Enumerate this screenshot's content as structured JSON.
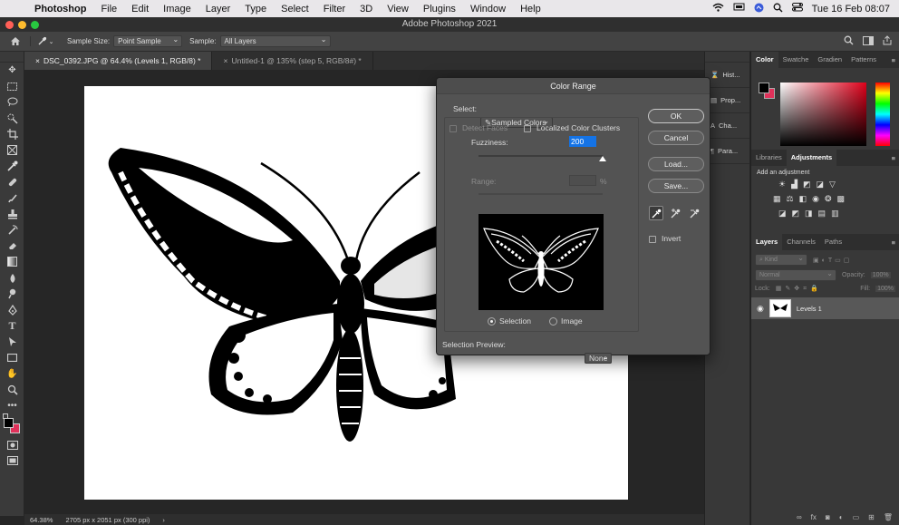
{
  "menubar": {
    "app": "Photoshop",
    "items": [
      "File",
      "Edit",
      "Image",
      "Layer",
      "Type",
      "Select",
      "Filter",
      "3D",
      "View",
      "Plugins",
      "Window",
      "Help"
    ],
    "clock": "Tue 16 Feb  08:07"
  },
  "window": {
    "title": "Adobe Photoshop 2021"
  },
  "options": {
    "sample_size_label": "Sample Size:",
    "sample_size_value": "Point Sample",
    "sample_label": "Sample:",
    "sample_value": "All Layers"
  },
  "tabs": [
    {
      "label": "DSC_0392.JPG @ 64.4% (Levels 1, RGB/8) *"
    },
    {
      "label": "Untitled-1 @ 135% (step 5, RGB/8#) *"
    }
  ],
  "status": {
    "zoom": "64.38%",
    "info": "2705 px x 2051 px (300 ppi)"
  },
  "dock": {
    "items": [
      "Hist...",
      "Prop...",
      "Cha...",
      "Para..."
    ]
  },
  "panels": {
    "color_tabs": [
      "Color",
      "Swatche",
      "Gradien",
      "Patterns"
    ],
    "adj_tabs": [
      "Libraries",
      "Adjustments"
    ],
    "adj_hint": "Add an adjustment",
    "layer_tabs": [
      "Layers",
      "Channels",
      "Paths"
    ],
    "kind": "Kind",
    "blend": "Normal",
    "opacity_label": "Opacity:",
    "opacity_value": "100%",
    "lock_label": "Lock:",
    "fill_label": "Fill:",
    "fill_value": "100%",
    "layer_name": "Levels 1"
  },
  "dialog": {
    "title": "Color Range",
    "select_label": "Select:",
    "select_value": "Sampled Colors",
    "detect_faces": "Detect Faces",
    "localized": "Localized Color Clusters",
    "fuzziness_label": "Fuzziness:",
    "fuzziness_value": "200",
    "fuzziness": 200,
    "range_label": "Range:",
    "range_unit": "%",
    "ok": "OK",
    "cancel": "Cancel",
    "load": "Load...",
    "save": "Save...",
    "invert": "Invert",
    "radio_selection": "Selection",
    "radio_image": "Image",
    "preview_label": "Selection Preview:",
    "preview_value": "None"
  },
  "colors": {
    "accent": "#1473e6",
    "fg_swatch": "#000000",
    "bg_swatch": "#e0315a"
  }
}
